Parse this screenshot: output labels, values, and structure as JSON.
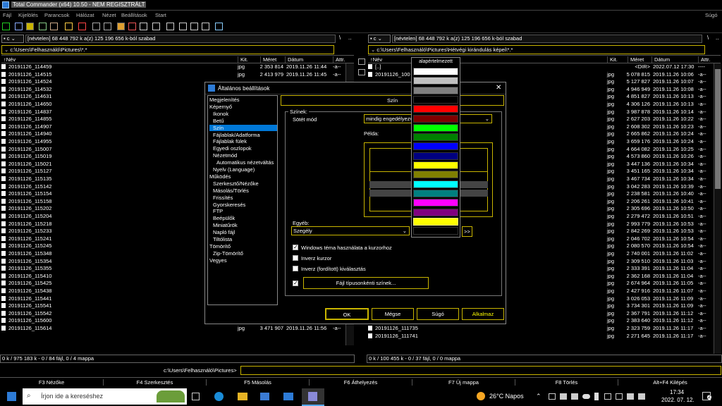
{
  "app": {
    "title": "Total Commander (x64) 10.50 - NEM REGISZTRÁLT"
  },
  "menu": [
    "Fájl",
    "Kijelölés",
    "Parancsok",
    "Hálózat",
    "Nézet",
    "Beállítások",
    "Start"
  ],
  "menu_right": "Súgó",
  "left": {
    "drive": "c",
    "drive_info": "[névtelen]  68 448 792 k a(z) 125 196 656 k-ból szabad",
    "path": "c:\\Users\\Felhasználó\\Pictures\\*.*",
    "cols": {
      "name": "↑Név",
      "ext": "Kit.",
      "size": "Méret",
      "date": "Dátum",
      "attr": "Attr."
    },
    "files": [
      {
        "n": "20191126_114459",
        "e": "jpg",
        "s": "2 353 814",
        "d": "2019.11.26 11:44",
        "a": "-a--"
      },
      {
        "n": "20191126_114515",
        "e": "jpg",
        "s": "2 413 979",
        "d": "2019.11.26 11:45",
        "a": "-a--"
      },
      {
        "n": "20191126_114524",
        "e": "",
        "s": "",
        "d": "",
        "a": ""
      },
      {
        "n": "20191126_114532",
        "e": "",
        "s": "",
        "d": "",
        "a": ""
      },
      {
        "n": "20191126_114631",
        "e": "",
        "s": "",
        "d": "",
        "a": ""
      },
      {
        "n": "20191126_114650",
        "e": "",
        "s": "",
        "d": "",
        "a": ""
      },
      {
        "n": "20191126_114837",
        "e": "",
        "s": "",
        "d": "",
        "a": ""
      },
      {
        "n": "20191126_114855",
        "e": "",
        "s": "",
        "d": "",
        "a": ""
      },
      {
        "n": "20191126_114907",
        "e": "",
        "s": "",
        "d": "",
        "a": ""
      },
      {
        "n": "20191126_114940",
        "e": "",
        "s": "",
        "d": "",
        "a": ""
      },
      {
        "n": "20191126_114955",
        "e": "",
        "s": "",
        "d": "",
        "a": ""
      },
      {
        "n": "20191126_115007",
        "e": "",
        "s": "",
        "d": "",
        "a": ""
      },
      {
        "n": "20191126_115019",
        "e": "",
        "s": "",
        "d": "",
        "a": ""
      },
      {
        "n": "20191126_115021",
        "e": "",
        "s": "",
        "d": "",
        "a": ""
      },
      {
        "n": "20191126_115127",
        "e": "",
        "s": "",
        "d": "",
        "a": ""
      },
      {
        "n": "20191126_115135",
        "e": "",
        "s": "",
        "d": "",
        "a": ""
      },
      {
        "n": "20191126_115142",
        "e": "",
        "s": "",
        "d": "",
        "a": ""
      },
      {
        "n": "20191126_115154",
        "e": "",
        "s": "",
        "d": "",
        "a": ""
      },
      {
        "n": "20191126_115158",
        "e": "",
        "s": "",
        "d": "",
        "a": ""
      },
      {
        "n": "20191126_115202",
        "e": "",
        "s": "",
        "d": "",
        "a": ""
      },
      {
        "n": "20191126_115204",
        "e": "",
        "s": "",
        "d": "",
        "a": ""
      },
      {
        "n": "20191126_115218",
        "e": "",
        "s": "",
        "d": "",
        "a": ""
      },
      {
        "n": "20191126_115233",
        "e": "",
        "s": "",
        "d": "",
        "a": ""
      },
      {
        "n": "20191126_115241",
        "e": "",
        "s": "",
        "d": "",
        "a": ""
      },
      {
        "n": "20191126_115245",
        "e": "",
        "s": "",
        "d": "",
        "a": ""
      },
      {
        "n": "20191126_115348",
        "e": "",
        "s": "",
        "d": "",
        "a": ""
      },
      {
        "n": "20191126_115354",
        "e": "",
        "s": "",
        "d": "",
        "a": ""
      },
      {
        "n": "20191126_115355",
        "e": "",
        "s": "",
        "d": "",
        "a": ""
      },
      {
        "n": "20191126_115410",
        "e": "",
        "s": "",
        "d": "",
        "a": ""
      },
      {
        "n": "20191126_115425",
        "e": "",
        "s": "",
        "d": "",
        "a": ""
      },
      {
        "n": "20191126_115438",
        "e": "",
        "s": "",
        "d": "",
        "a": ""
      },
      {
        "n": "20191126_115441",
        "e": "",
        "s": "",
        "d": "",
        "a": ""
      },
      {
        "n": "20191126_115541",
        "e": "",
        "s": "",
        "d": "",
        "a": ""
      },
      {
        "n": "20191126_115542",
        "e": "jpg",
        "s": "3 053 896",
        "d": "2019.11.26 11:55",
        "a": "-a--"
      },
      {
        "n": "20191126_115600",
        "e": "jpg",
        "s": "2 935 744",
        "d": "2019.11.26 11:56",
        "a": "-a--"
      },
      {
        "n": "20191126_115614",
        "e": "jpg",
        "s": "3 471 907",
        "d": "2019.11.26 11:56",
        "a": "-a--"
      }
    ],
    "status": "0 k / 975 183 k - 0 / 84 fájl, 0 / 4 mappa"
  },
  "right": {
    "drive": "c",
    "drive_info": "[névtelen]  68 448 792 k a(z) 125 196 656 k-ból szabad",
    "path": "c:\\Users\\Felhasználó\\Pictures\\Hétvégi kirándulás képei\\*.*",
    "cols": {
      "name": "↑Név",
      "ext": "Kit.",
      "size": "Méret",
      "date": "Dátum",
      "attr": "Attr."
    },
    "files": [
      {
        "n": "[..]",
        "e": "",
        "s": "<DIR>",
        "d": "2022.07.12 17:30",
        "a": "----"
      },
      {
        "n": "20191126_100",
        "e": "jpg",
        "s": "5 078 815",
        "d": "2019.11.26 10:06",
        "a": "-a--"
      },
      {
        "n": "",
        "e": "jpg",
        "s": "5 127 827",
        "d": "2019.11.26 10:07",
        "a": "-a--"
      },
      {
        "n": "",
        "e": "jpg",
        "s": "4 946 949",
        "d": "2019.11.26 10:08",
        "a": "-a--"
      },
      {
        "n": "",
        "e": "jpg",
        "s": "4 851 827",
        "d": "2019.11.26 10:13",
        "a": "-a--"
      },
      {
        "n": "",
        "e": "jpg",
        "s": "4 306 126",
        "d": "2019.11.26 10:13",
        "a": "-a--"
      },
      {
        "n": "",
        "e": "jpg",
        "s": "3 987 878",
        "d": "2019.11.26 10:14",
        "a": "-a--"
      },
      {
        "n": "",
        "e": "jpg",
        "s": "2 627 203",
        "d": "2019.11.26 10:22",
        "a": "-a--"
      },
      {
        "n": "",
        "e": "jpg",
        "s": "2 608 302",
        "d": "2019.11.26 10:23",
        "a": "-a--"
      },
      {
        "n": "",
        "e": "jpg",
        "s": "2 665 862",
        "d": "2019.11.26 10:24",
        "a": "-a--"
      },
      {
        "n": "",
        "e": "jpg",
        "s": "3 659 176",
        "d": "2019.11.26 10:24",
        "a": "-a--"
      },
      {
        "n": "",
        "e": "jpg",
        "s": "4 664 082",
        "d": "2019.11.26 10:25",
        "a": "-a--"
      },
      {
        "n": "",
        "e": "jpg",
        "s": "4 573 860",
        "d": "2019.11.26 10:26",
        "a": "-a--"
      },
      {
        "n": "",
        "e": "jpg",
        "s": "3 447 136",
        "d": "2019.11.26 10:34",
        "a": "-a--"
      },
      {
        "n": "",
        "e": "jpg",
        "s": "3 451 165",
        "d": "2019.11.26 10:34",
        "a": "-a--"
      },
      {
        "n": "",
        "e": "jpg",
        "s": "3 467 734",
        "d": "2019.11.26 10:34",
        "a": "-a--"
      },
      {
        "n": "",
        "e": "jpg",
        "s": "3 042 283",
        "d": "2019.11.26 10:39",
        "a": "-a--"
      },
      {
        "n": "",
        "e": "jpg",
        "s": "2 238 581",
        "d": "2019.11.26 10:40",
        "a": "-a--"
      },
      {
        "n": "",
        "e": "jpg",
        "s": "2 206 261",
        "d": "2019.11.26 10:41",
        "a": "-a--"
      },
      {
        "n": "",
        "e": "jpg",
        "s": "2 305 696",
        "d": "2019.11.26 10:50",
        "a": "-a--"
      },
      {
        "n": "",
        "e": "jpg",
        "s": "2 279 472",
        "d": "2019.11.26 10:51",
        "a": "-a--"
      },
      {
        "n": "",
        "e": "jpg",
        "s": "2 993 779",
        "d": "2019.11.26 10:53",
        "a": "-a--"
      },
      {
        "n": "",
        "e": "jpg",
        "s": "2 842 269",
        "d": "2019.11.26 10:53",
        "a": "-a--"
      },
      {
        "n": "",
        "e": "jpg",
        "s": "2 046 702",
        "d": "2019.11.26 10:54",
        "a": "-a--"
      },
      {
        "n": "",
        "e": "jpg",
        "s": "2 080 570",
        "d": "2019.11.26 10:54",
        "a": "-a--"
      },
      {
        "n": "",
        "e": "jpg",
        "s": "2 740 001",
        "d": "2019.11.26 11:02",
        "a": "-a--"
      },
      {
        "n": "",
        "e": "jpg",
        "s": "2 309 510",
        "d": "2019.11.26 11:03",
        "a": "-a--"
      },
      {
        "n": "",
        "e": "jpg",
        "s": "2 333 391",
        "d": "2019.11.26 11:04",
        "a": "-a--"
      },
      {
        "n": "",
        "e": "jpg",
        "s": "2 362 168",
        "d": "2019.11.26 11:04",
        "a": "-a--"
      },
      {
        "n": "",
        "e": "jpg",
        "s": "2 674 964",
        "d": "2019.11.26 11:05",
        "a": "-a--"
      },
      {
        "n": "",
        "e": "jpg",
        "s": "2 427 916",
        "d": "2019.11.26 11:07",
        "a": "-a--"
      },
      {
        "n": "",
        "e": "jpg",
        "s": "3 026 053",
        "d": "2019.11.26 11:09",
        "a": "-a--"
      },
      {
        "n": "",
        "e": "jpg",
        "s": "3 734 301",
        "d": "2019.11.26 11:09",
        "a": "-a--"
      },
      {
        "n": "20191126_111253",
        "e": "jpg",
        "s": "2 367 791",
        "d": "2019.11.26 11:12",
        "a": "-a--"
      },
      {
        "n": "20191126_111259",
        "e": "jpg",
        "s": "2 383 640",
        "d": "2019.11.26 11:12",
        "a": "-a--"
      },
      {
        "n": "20191126_111735",
        "e": "jpg",
        "s": "2 323 759",
        "d": "2019.11.26 11:17",
        "a": "-a--"
      },
      {
        "n": "20191126_111741",
        "e": "jpg",
        "s": "2 271 645",
        "d": "2019.11.26 11:17",
        "a": "-a--"
      }
    ],
    "status": "0 k / 100 455 k - 0 / 37 fájl, 0 / 0 mappa"
  },
  "cmdline": {
    "path": "c:\\Users\\Felhasználó\\Pictures>"
  },
  "fkeys": [
    "F3 Nézőke",
    "F4 Szerkesztés",
    "F5 Másolás",
    "F6 Áthelyezés",
    "F7 Új mappa",
    "F8 Törlés",
    "Alt+F4 Kilépés"
  ],
  "dialog": {
    "title": "Általános beállítások",
    "tree": [
      {
        "t": "Megjelenítés",
        "i": 0
      },
      {
        "t": "Képernyő",
        "i": 0
      },
      {
        "t": "Ikonok",
        "i": 1
      },
      {
        "t": "Betű",
        "i": 1
      },
      {
        "t": "Szín",
        "i": 1,
        "sel": true
      },
      {
        "t": "Fájlablak/Adatforma",
        "i": 1
      },
      {
        "t": "Fájlablak fülek",
        "i": 1
      },
      {
        "t": "Egyedi oszlopok",
        "i": 1
      },
      {
        "t": "Nézetmód",
        "i": 1
      },
      {
        "t": "Automatikus nézetváltás",
        "i": 2
      },
      {
        "t": "Nyelv (Language)",
        "i": 1
      },
      {
        "t": "Működés",
        "i": 0
      },
      {
        "t": "Szerkesztő/Nézőke",
        "i": 1
      },
      {
        "t": "Másolás/Törlés",
        "i": 1
      },
      {
        "t": "Frissítés",
        "i": 1
      },
      {
        "t": "Gyorskeresés",
        "i": 1
      },
      {
        "t": "FTP",
        "i": 1
      },
      {
        "t": "Beépülők",
        "i": 1
      },
      {
        "t": "Miniatűrök",
        "i": 1
      },
      {
        "t": "Napló fájl",
        "i": 1
      },
      {
        "t": "Tiltólista",
        "i": 1
      },
      {
        "t": "Tömörítő",
        "i": 0
      },
      {
        "t": "Zip-Tömörítő",
        "i": 1
      },
      {
        "t": "Vegyes",
        "i": 0
      }
    ],
    "page_title": "Szín",
    "group_label": "Színek:",
    "dark_mode_label": "Sötét mód",
    "dark_mode_value": "mindig engedélyezve",
    "example_label": "Példa:",
    "other_label": "Egyéb:",
    "other_value": "Szegély",
    "more_button": ">>",
    "cb_windows_theme": "Windows téma használata a kurzorhoz",
    "cb_inverse_cursor": "Inverz kurzor",
    "cb_inverse_selection": "Inverz (fordított) kiválasztás",
    "filetype_button": "Fájl típusonkénti színek...",
    "buttons": {
      "ok": "OK",
      "cancel": "Mégse",
      "help": "Súgó",
      "apply": "Alkalmaz"
    }
  },
  "palette": {
    "header": "alapértelmezett",
    "colors": [
      "#ffffff",
      "#c0c0c0",
      "#808080",
      "#000000",
      "#ff0000",
      "#800000",
      "#00ff00",
      "#008000",
      "#0000ff",
      "#000080",
      "#ffff00",
      "#808000",
      "#00ffff",
      "#008080",
      "#ff00ff",
      "#800080",
      "#ffff00",
      "#000000"
    ]
  },
  "taskbar": {
    "search_placeholder": "Írjon ide a kereséshez",
    "weather": "26°C  Napos",
    "time": "17:34",
    "date": "2022. 07. 12.",
    "notif_count": "2"
  },
  "colors": {
    "accent_yellow": "#c8b400",
    "selection_blue": "#0078d7"
  }
}
